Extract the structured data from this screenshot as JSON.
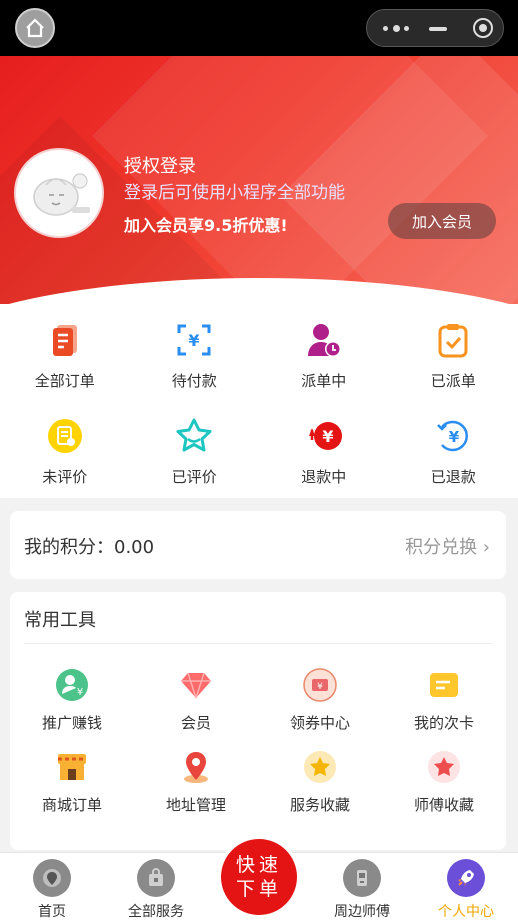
{
  "colors": {
    "brand_red": "#e41414",
    "active_tab": "#f0a500",
    "muted_text": "#999999"
  },
  "header": {
    "title": "授权登录",
    "subtitle": "登录后可使用小程序全部功能",
    "member_promo": "加入会员享9.5折优惠!",
    "join_button": "加入会员"
  },
  "orders": [
    {
      "label": "全部订单",
      "icon": "document-icon"
    },
    {
      "label": "待付款",
      "icon": "yuan-scan-icon"
    },
    {
      "label": "派单中",
      "icon": "person-clock-icon"
    },
    {
      "label": "已派单",
      "icon": "clipboard-check-icon"
    },
    {
      "label": "未评价",
      "icon": "yellow-document-icon"
    },
    {
      "label": "已评价",
      "icon": "star-outline-icon"
    },
    {
      "label": "退款中",
      "icon": "refund-icon"
    },
    {
      "label": "已退款",
      "icon": "refunded-icon"
    }
  ],
  "points": {
    "label": "我的积分：0.00",
    "link": "积分兑换 ›"
  },
  "tools": {
    "title": "常用工具",
    "items": [
      {
        "label": "推广赚钱",
        "icon": "promote-user-icon"
      },
      {
        "label": "会员",
        "icon": "diamond-icon"
      },
      {
        "label": "领券中心",
        "icon": "coupon-icon"
      },
      {
        "label": "我的次卡",
        "icon": "card-icon"
      },
      {
        "label": "商城订单",
        "icon": "shop-icon"
      },
      {
        "label": "地址管理",
        "icon": "location-pin-icon"
      },
      {
        "label": "服务收藏",
        "icon": "star-badge-icon"
      },
      {
        "label": "师傅收藏",
        "icon": "star-red-icon"
      }
    ]
  },
  "tabbar": {
    "items": [
      {
        "label": "首页",
        "icon": "home-pin-icon"
      },
      {
        "label": "全部服务",
        "icon": "bag-icon"
      },
      {
        "label": "周边师傅",
        "icon": "device-icon"
      },
      {
        "label": "个人中心",
        "icon": "rocket-icon"
      }
    ],
    "quick_line1": "快速",
    "quick_line2": "下单"
  }
}
